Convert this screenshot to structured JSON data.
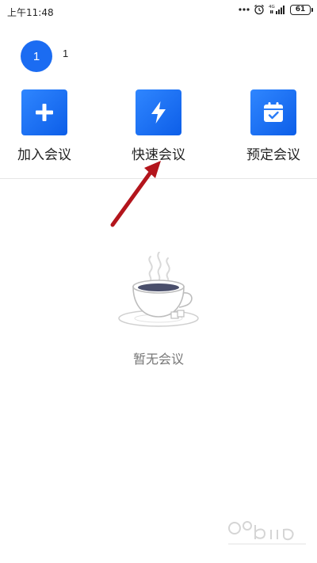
{
  "status_bar": {
    "time": "上午11:48",
    "network": "4G",
    "battery": "61"
  },
  "user": {
    "avatar_text": "1",
    "name": "1"
  },
  "actions": [
    {
      "label": "加入会议",
      "icon": "plus-icon"
    },
    {
      "label": "快速会议",
      "icon": "lightning-icon"
    },
    {
      "label": "预定会议",
      "icon": "calendar-check-icon"
    }
  ],
  "empty_state": {
    "text": "暂无会议",
    "illustration": "coffee-cup-icon"
  },
  "colors": {
    "accent": "#1b6cf2",
    "arrow": "#b3151c",
    "muted_text": "#777777"
  }
}
